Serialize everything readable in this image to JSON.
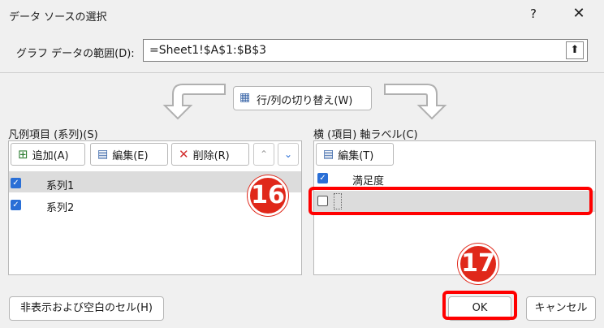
{
  "window": {
    "title": "データ ソースの選択",
    "help_glyph": "?",
    "close_glyph": "✕"
  },
  "range": {
    "label": "グラフ データの範囲(D):",
    "value": "=Sheet1!$A$1:$B$3",
    "collapse_glyph": "⬆"
  },
  "switch": {
    "label": "行/列の切り替え(W)"
  },
  "legend": {
    "section_label": "凡例項目 (系列)(S)",
    "add_label": "追加(A)",
    "edit_label": "編集(E)",
    "delete_label": "削除(R)",
    "up_glyph": "⌃",
    "down_glyph": "⌄",
    "series": [
      {
        "name": "系列1",
        "checked": true
      },
      {
        "name": "系列2",
        "checked": true
      }
    ]
  },
  "axis": {
    "section_label": "横 (項目) 軸ラベル(C)",
    "edit_label": "編集(T)",
    "items": [
      {
        "name": "満足度",
        "checked": true
      },
      {
        "name": "",
        "checked": false
      }
    ]
  },
  "annotations": {
    "step16": "16",
    "step17": "17"
  },
  "buttons": {
    "hidden_cells": "非表示および空白のセル(H)",
    "ok": "OK",
    "cancel": "キャンセル"
  },
  "colors": {
    "accent": "#2a6fd6",
    "annotation_red": "#ff0000"
  }
}
